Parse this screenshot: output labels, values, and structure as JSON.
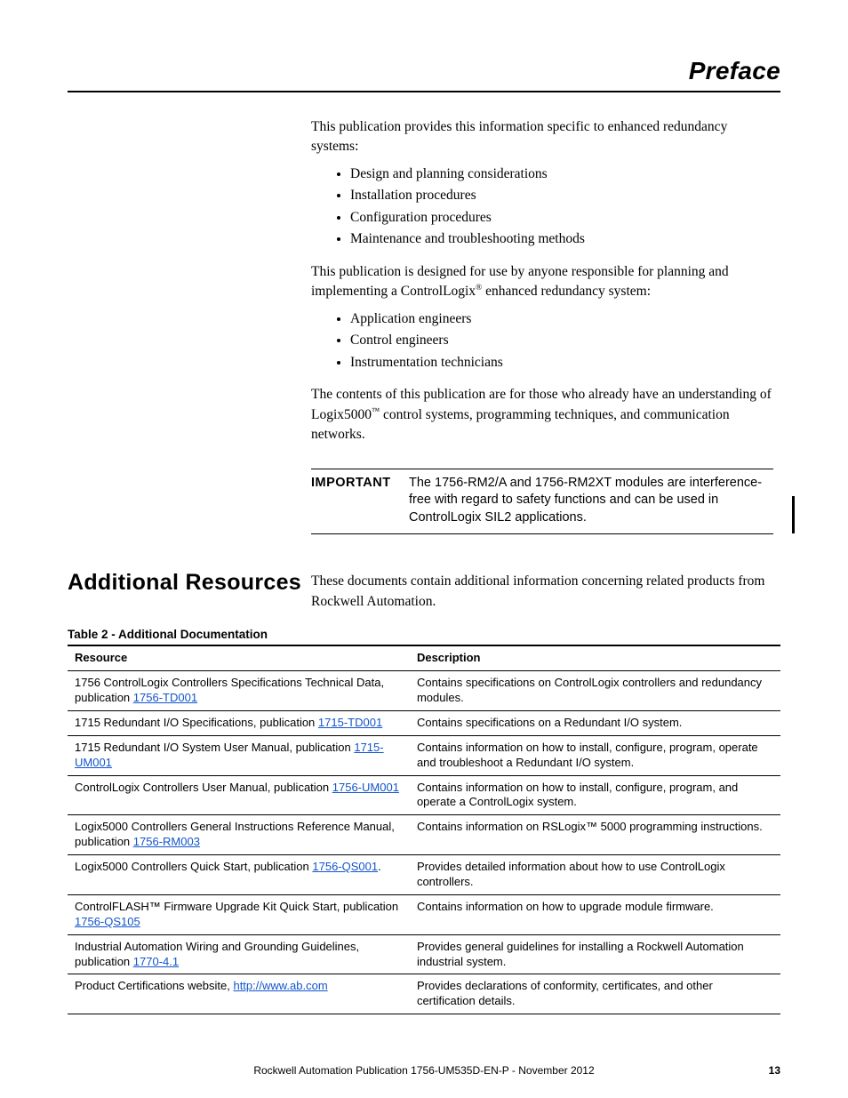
{
  "header": {
    "title": "Preface"
  },
  "intro": {
    "p1": "This publication provides this information specific to enhanced redundancy systems:",
    "list1": [
      "Design and planning considerations",
      "Installation procedures",
      "Configuration procedures",
      "Maintenance and troubleshooting methods"
    ],
    "p2_before": "This publication is designed for use by anyone responsible for planning and implementing a ControlLogix",
    "p2_after": " enhanced redundancy system:",
    "list2": [
      "Application engineers",
      "Control engineers",
      "Instrumentation technicians"
    ],
    "p3_before": "The contents of this publication are for those who already have an understanding of Logix5000",
    "p3_after": " control systems, programming techniques, and communication networks."
  },
  "important": {
    "label": "IMPORTANT",
    "text": "The 1756-RM2/A and 1756-RM2XT modules are interference-free with regard to safety functions and can be used in ControlLogix SIL2 applications."
  },
  "section": {
    "heading": "Additional Resources",
    "intro": "These documents contain additional information concerning related products from Rockwell Automation."
  },
  "table": {
    "caption": "Table 2 - Additional Documentation",
    "headers": {
      "resource": "Resource",
      "description": "Description"
    },
    "rows": [
      {
        "res_text": "1756 ControlLogix Controllers Specifications Technical Data, publication ",
        "res_link": "1756-TD001",
        "res_suffix": "",
        "desc": "Contains specifications on ControlLogix controllers and redundancy modules."
      },
      {
        "res_text": "1715 Redundant I/O Specifications, publication ",
        "res_link": "1715-TD001",
        "res_suffix": "",
        "desc": "Contains specifications on a Redundant I/O system."
      },
      {
        "res_text": "1715 Redundant I/O System User Manual, publication ",
        "res_link": "1715-UM001",
        "res_suffix": "",
        "desc": "Contains information on how to install, configure, program, operate and troubleshoot a Redundant I/O system."
      },
      {
        "res_text": "ControlLogix Controllers User Manual, publication ",
        "res_link": "1756-UM001",
        "res_suffix": "",
        "desc": "Contains information on how to install, configure, program, and operate a ControlLogix system."
      },
      {
        "res_text": "Logix5000 Controllers General Instructions Reference Manual, publication ",
        "res_link": "1756-RM003",
        "res_suffix": "",
        "desc": "Contains information on RSLogix™ 5000 programming instructions."
      },
      {
        "res_text": "Logix5000 Controllers Quick Start, publication ",
        "res_link": "1756-QS001",
        "res_suffix": ".",
        "desc": "Provides detailed information about how to use ControlLogix controllers."
      },
      {
        "res_text": "ControlFLASH™ Firmware Upgrade Kit Quick Start, publication ",
        "res_link": "1756-QS105",
        "res_suffix": "",
        "desc": "Contains information on how to upgrade module firmware."
      },
      {
        "res_text": "Industrial Automation Wiring and Grounding Guidelines, publication ",
        "res_link": "1770-4.1",
        "res_suffix": "",
        "desc": "Provides general guidelines for installing a Rockwell Automation industrial system."
      },
      {
        "res_text": "Product Certifications website, ",
        "res_link": "http://www.ab.com",
        "res_suffix": "",
        "desc": "Provides declarations of conformity, certificates, and other certification details."
      }
    ]
  },
  "footer": {
    "text": "Rockwell Automation Publication 1756-UM535D-EN-P - November 2012",
    "page": "13"
  }
}
